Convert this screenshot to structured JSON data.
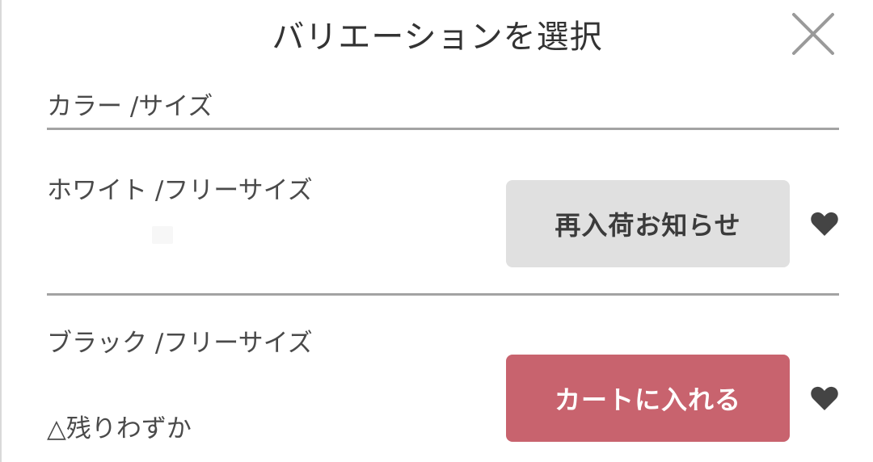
{
  "modal": {
    "title": "バリエーションを選択"
  },
  "header": {
    "label": "カラー /サイズ"
  },
  "variants": [
    {
      "label": "ホワイト /フリーサイズ",
      "action_label": "再入荷お知らせ",
      "stock_text": ""
    },
    {
      "label": "ブラック /フリーサイズ",
      "action_label": "カートに入れる",
      "stock_text": "△残りわずか"
    }
  ],
  "icons": {
    "close": "close-icon",
    "favorite": "heart-icon"
  },
  "colors": {
    "cart_button": "#c8636e",
    "notify_button": "#e0e0e0",
    "divider": "#a3a3a3",
    "heart": "#444444"
  }
}
